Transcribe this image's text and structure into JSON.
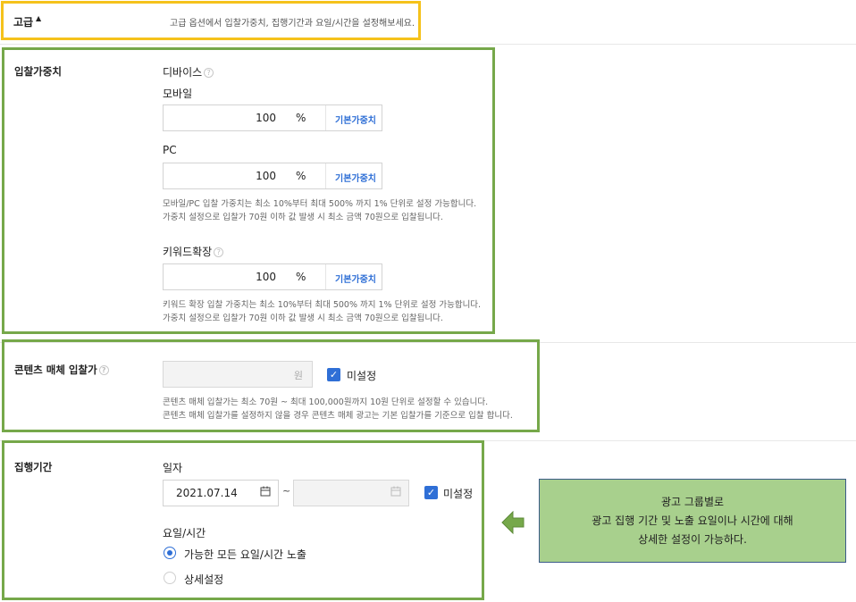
{
  "advanced": {
    "title": "고급",
    "arrow": "▲",
    "description": "고급 옵션에서 입찰가중치, 집행기간과 요일/시간을 설정해보세요."
  },
  "bid_weight": {
    "section_title": "입찰가중치",
    "device_label": "디바이스",
    "help_glyph": "?",
    "mobile": {
      "label": "모바일",
      "value": "100",
      "unit": "%",
      "default_label": "기본가중치"
    },
    "pc": {
      "label": "PC",
      "value": "100",
      "unit": "%",
      "default_label": "기본가중치"
    },
    "device_note_1": "모바일/PC 입찰 가중치는 최소 10%부터 최대 500% 까지 1% 단위로 설정 가능합니다.",
    "device_note_2": "가중치 설정으로 입찰가 70원 이하 값 발생 시 최소 금액 70원으로 입찰됩니다.",
    "keyword": {
      "label": "키워드확장",
      "value": "100",
      "unit": "%",
      "default_label": "기본가중치"
    },
    "keyword_note_1": "키워드 확장 입찰 가중치는 최소 10%부터 최대 500% 까지 1% 단위로 설정 가능합니다.",
    "keyword_note_2": "가중치 설정으로 입찰가 70원 이하 값 발생 시 최소 금액 70원으로 입찰됩니다."
  },
  "content_bid": {
    "section_title": "콘텐츠 매체 입찰가",
    "input_unit": "원",
    "checkbox_label": "미설정",
    "checked": true,
    "note_1": "콘텐츠 매체 입찰가는 최소 70원 ~ 최대 100,000원까지 10원 단위로 설정할 수 있습니다.",
    "note_2": "콘텐츠 매체 입찰가를 설정하지 않을 경우 콘텐츠 매체 광고는 기본 입찰가를 기준으로 입찰 합니다."
  },
  "schedule": {
    "section_title": "집행기간",
    "date_label": "일자",
    "start_date": "2021.07.14",
    "tilde": "~",
    "end_checkbox_label": "미설정",
    "end_checked": true,
    "day_time_label": "요일/시간",
    "options": [
      {
        "label": "가능한 모든 요일/시간 노출",
        "selected": true
      },
      {
        "label": "상세설정",
        "selected": false
      }
    ]
  },
  "callout": {
    "line1": "광고 그룹별로",
    "line2": "광고 집행 기간 및 노출 요일이나 시간에 대해",
    "line3": "상세한 설정이 가능하다."
  },
  "colors": {
    "accent_blue": "#2f6fd6",
    "highlight_yellow": "#f5c21b",
    "highlight_green": "#76a84a",
    "callout_fill": "#a8d08d"
  }
}
